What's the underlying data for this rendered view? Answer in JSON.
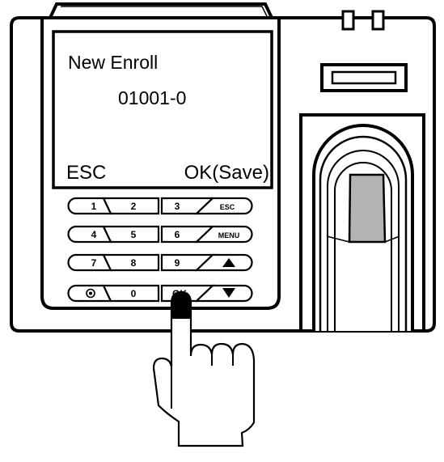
{
  "screen": {
    "title": "New Enroll",
    "user_id": "01001-0",
    "left_softkey": "ESC",
    "right_softkey": "OK(Save)"
  },
  "keypad": {
    "row1": {
      "k1": "1",
      "k2": "2",
      "k3": "3",
      "k4": "ESC"
    },
    "row2": {
      "k1": "4",
      "k2": "5",
      "k3": "6",
      "k4": "MENU"
    },
    "row3": {
      "k1": "7",
      "k2": "8",
      "k3": "9",
      "k4_icon": "up-arrow-icon"
    },
    "row4": {
      "k1_icon": "power-dot-icon",
      "k2": "0",
      "k3": "OK",
      "k4_icon": "down-arrow-icon"
    }
  },
  "colors": {
    "outline": "#000000",
    "background": "#ffffff",
    "sensor_window": "#b3b3b3"
  }
}
